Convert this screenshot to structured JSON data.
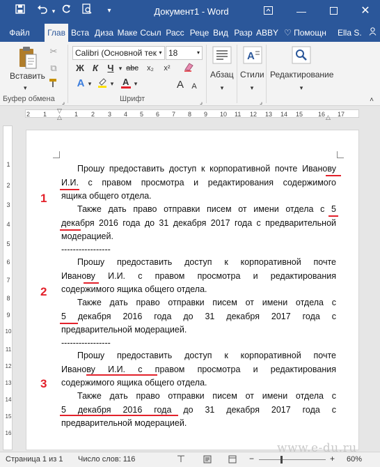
{
  "window": {
    "title": "Документ1 - Word",
    "colors": {
      "titlebar": "#2b579a",
      "accent_red": "#e3212b"
    }
  },
  "quick_access": {
    "icons": [
      "save-icon",
      "undo-icon",
      "redo-icon",
      "print-preview-icon",
      "customize-icon"
    ]
  },
  "tabs": [
    {
      "label": "Файл",
      "active": false
    },
    {
      "label": "Глав",
      "active": true
    },
    {
      "label": "Вста",
      "active": false
    },
    {
      "label": "Диза",
      "active": false
    },
    {
      "label": "Маке",
      "active": false
    },
    {
      "label": "Ссыл",
      "active": false
    },
    {
      "label": "Расс",
      "active": false
    },
    {
      "label": "Реце",
      "active": false
    },
    {
      "label": "Вид",
      "active": false
    },
    {
      "label": "Разр",
      "active": false
    },
    {
      "label": "ABBY",
      "active": false
    }
  ],
  "tell_me": "Помощн",
  "user": "Ella S.",
  "ribbon": {
    "paste_label": "Вставить",
    "clipboard_label": "Буфер обмена",
    "font_label": "Шрифт",
    "font_name": "Calibri (Основной текст)",
    "font_size": "18",
    "bold": "Ж",
    "italic": "К",
    "underline": "Ч",
    "paragraph_label": "Абзац",
    "styles_label": "Стили",
    "editing_label": "Редактирование"
  },
  "ruler": {
    "numbers": [
      "2",
      "1",
      "1",
      "2",
      "3",
      "4",
      "5",
      "6",
      "7",
      "8",
      "9",
      "10",
      "11",
      "12",
      "13",
      "14",
      "15",
      "16",
      "17"
    ],
    "vertical": [
      "1",
      "2",
      "3",
      "4",
      "5",
      "6",
      "7",
      "8",
      "9",
      "10",
      "11",
      "12",
      "13",
      "14",
      "15",
      "16"
    ]
  },
  "document": {
    "labels": [
      "1",
      "2",
      "3"
    ],
    "separator": "-----------------",
    "variant1": {
      "p1": [
        "Прошу предоставить доступ к корпоративной почте Иванову",
        "И.И. с правом просмотра и редактирования содержимого",
        "ящика общего отдела."
      ],
      "p2": [
        "Также дать право отправки писем от имени отдела с 5",
        "декабря 2016 года до 31 декабря 2017 года с предварительной",
        "модерацией."
      ]
    },
    "variant2": {
      "p1": [
        "Прошу предоставить доступ к корпоративной почте",
        "Иванову И.И. с правом просмотра и редактирования",
        "содержимого ящика общего отдела."
      ],
      "p2": [
        "Также дать право отправки писем от имени отдела с",
        "5 декабря 2016 года до 31 декабря 2017 года с",
        "предварительной модерацией."
      ]
    },
    "variant3": {
      "p1": [
        "Прошу предоставить доступ к корпоративной почте",
        "Иванову И.И. с правом просмотра и редактирования",
        "содержимого ящика общего отдела."
      ],
      "p2": [
        "Также дать право отправки писем от имени отдела с",
        "5 декабря 2016 года до 31 декабря 2017 года с",
        "предварительной модерацией."
      ]
    }
  },
  "status": {
    "page": "Страница 1 из 1",
    "words": "Число слов: 116",
    "zoom": "60%",
    "zoom_minus": "−",
    "zoom_plus": "+"
  },
  "watermark": "www.e-du.ru"
}
